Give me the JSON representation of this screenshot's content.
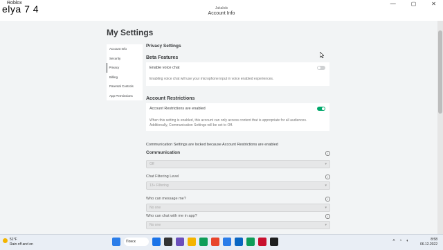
{
  "window": {
    "title": "Roblox",
    "overlay_text": "elya 7 4",
    "controls": [
      "—",
      "▢",
      "✕"
    ],
    "header_small": "Jakakds",
    "header_title": "Account Info"
  },
  "page": {
    "title": "My Settings"
  },
  "sidebar": {
    "items": [
      {
        "label": "Account Info",
        "active": false
      },
      {
        "label": "Security",
        "active": false
      },
      {
        "label": "Privacy",
        "active": true
      },
      {
        "label": "Billing",
        "active": false
      },
      {
        "label": "Parental Controls",
        "active": false
      },
      {
        "label": "App Permissions",
        "active": false
      }
    ]
  },
  "privacy": {
    "section_title": "Privacy Settings",
    "beta": {
      "title": "Beta Features",
      "toggle_label": "Enable voice chat",
      "toggle_on": false,
      "description": "Enabling voice chat will use your microphone input in voice enabled experiences."
    },
    "restrictions": {
      "title": "Account Restrictions",
      "toggle_label": "Account Restrictions are enabled",
      "toggle_on": true,
      "description": "When this setting is enabled, this account can only access content that is appropriate for all audiences. Additionally, Communication Settings will be set to Off."
    },
    "locked_note": "Communication Settings are locked because Account Restrictions are enabled",
    "communication": {
      "title": "Communication",
      "value": "Off",
      "chat_filter_label": "Chat Filtering Level",
      "chat_filter_value": "13+ Filtering",
      "message_label": "Who can message me?",
      "message_value": "No one",
      "chat_label": "Who can chat with me in app?",
      "chat_value": "No one"
    }
  },
  "taskbar": {
    "weather_temp": "51°F",
    "weather_desc": "Rain off and on",
    "search_label": "Поиск",
    "time": "8:58",
    "date": "06.12.2022",
    "icon_colors": [
      "#1a73e8",
      "#333333",
      "#6b4fbb",
      "#f4b400",
      "#0f9d58",
      "#e8452c",
      "#2b7de9",
      "#0a66c2",
      "#0f9d58",
      "#c8102e",
      "#1f1f1f",
      "#e04e39"
    ]
  },
  "colors": {
    "toggle_on": "#00a86b",
    "toggle_off": "#cfd1d3",
    "background": "#f2f4f5"
  }
}
